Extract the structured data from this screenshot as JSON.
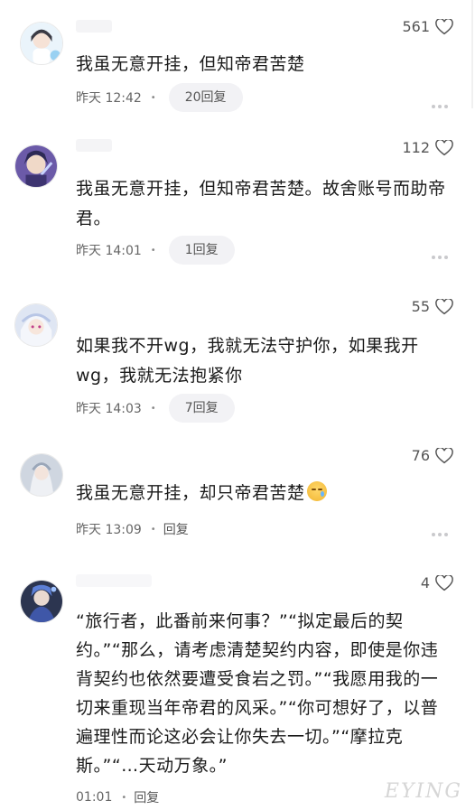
{
  "comments": [
    {
      "likes": "561",
      "text": "我虽无意开挂，但知帝君苦楚",
      "time": "昨天 12:42",
      "reply": "20回复"
    },
    {
      "likes": "112",
      "text": "我虽无意开挂，但知帝君苦楚。故舍账号而助帝君。",
      "time": "昨天 14:01",
      "reply": "1回复"
    },
    {
      "likes": "55",
      "text": "如果我不开wg，我就无法守护你，如果我开wg，我就无法抱紧你",
      "time": "昨天 14:03",
      "reply": "7回复"
    },
    {
      "likes": "76",
      "text": "我虽无意开挂，却只帝君苦楚",
      "time": "昨天 13:09",
      "reply": "回复"
    },
    {
      "likes": "4",
      "text": "“旅行者，此番前来何事？”“拟定最后的契约。”“那么，请考虑清楚契约内容，即使是你违背契约也依然要遭受食岩之罚。”“我愿用我的一切来重现当年帝君的风采。”“你可想好了，以普遍理性而论这必会让你失去一切。”“摩拉克斯。”“…天动万象。”",
      "time": "01:01",
      "reply": "回复"
    }
  ],
  "separator": "•",
  "watermark": "EYING",
  "icons": [
    "heart-icon",
    "more-icon",
    "avatar"
  ],
  "colors": {
    "pill_bg": "#f2f2f5",
    "text": "#1b1b1b",
    "meta": "#666666"
  }
}
